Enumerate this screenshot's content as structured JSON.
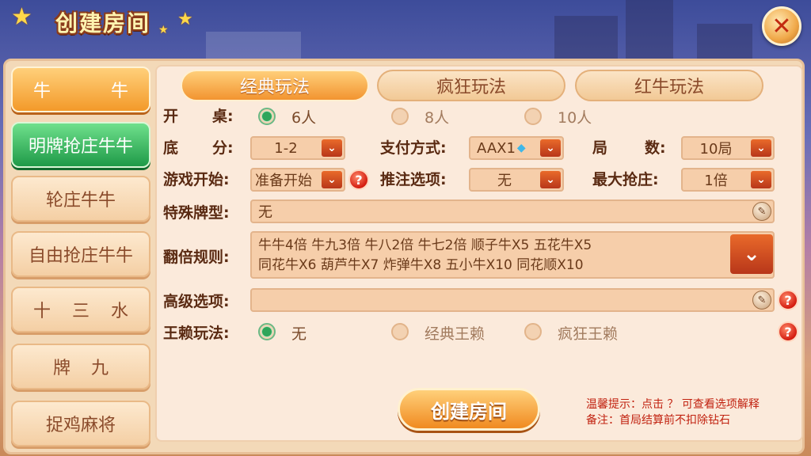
{
  "title": "创建房间",
  "close_label": "✕",
  "left_tabs": [
    {
      "label_a": "牛",
      "label_b": "牛"
    },
    {
      "label": "明牌抢庄牛牛"
    },
    {
      "label": "轮庄牛牛"
    },
    {
      "label": "自由抢庄牛牛"
    },
    {
      "label_a": "十",
      "label_m": "三",
      "label_b": "水"
    },
    {
      "label_a": "牌",
      "label_b": "九"
    },
    {
      "label": "捉鸡麻将"
    }
  ],
  "top_tabs": [
    "经典玩法",
    "疯狂玩法",
    "红牛玩法"
  ],
  "table": {
    "label_a": "开",
    "label_b": "桌:",
    "options": [
      "6人",
      "8人",
      "10人"
    ],
    "selected": "6人"
  },
  "base_score": {
    "label_a": "底",
    "label_b": "分:",
    "value": "1-2"
  },
  "payment": {
    "label": "支付方式:",
    "value": "AAX1"
  },
  "rounds": {
    "label_a": "局",
    "label_b": "数:",
    "value": "10局"
  },
  "game_start": {
    "label": "游戏开始:",
    "value": "准备开始"
  },
  "bet_option": {
    "label": "推注选项:",
    "value": "无"
  },
  "max_banker": {
    "label": "最大抢庄:",
    "value": "1倍"
  },
  "special_cards": {
    "label": "特殊牌型:",
    "value": "无"
  },
  "double_rules": {
    "label": "翻倍规则:",
    "line1": "牛牛4倍 牛九3倍 牛八2倍 牛七2倍 顺子牛X5 五花牛X5",
    "line2": "同花牛X6 葫芦牛X7 炸弹牛X8 五小牛X10 同花顺X10"
  },
  "advanced": {
    "label": "高级选项:",
    "value": ""
  },
  "wildcard": {
    "label": "王赖玩法:",
    "options": [
      "无",
      "经典王赖",
      "疯狂王赖"
    ],
    "selected": "无"
  },
  "create_button": "创建房间",
  "hint_line1": "温馨提示：点击 ？ 可查看选项解释",
  "hint_line2": "备注：首局结算前不扣除钻石",
  "colors": {
    "accent": "#f29430",
    "green": "#1f9a48",
    "hint": "#c12210"
  },
  "icons": {
    "diamond": "diamond-icon",
    "pin": "pin-icon",
    "help": "help-icon"
  }
}
